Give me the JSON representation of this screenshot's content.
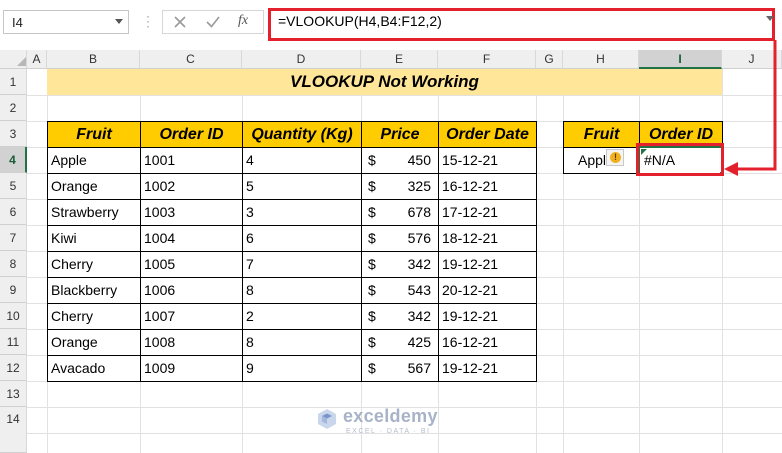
{
  "formula_bar": {
    "name_box": "I4",
    "formula": "=VLOOKUP(H4,B4:F12,2)",
    "fx_label": "fx"
  },
  "columns": [
    "A",
    "B",
    "C",
    "D",
    "E",
    "F",
    "G",
    "H",
    "I",
    "J"
  ],
  "rows": [
    "1",
    "2",
    "3",
    "4",
    "5",
    "6",
    "7",
    "8",
    "9",
    "10",
    "11",
    "12",
    "13",
    "14"
  ],
  "selected_cell": "I4",
  "title": "VLOOKUP Not Working",
  "table": {
    "headers": [
      "Fruit",
      "Order ID",
      "Quantity (Kg)",
      "Price",
      "Order Date"
    ],
    "rows": [
      {
        "fruit": "Apple",
        "order_id": "1001",
        "qty": "4",
        "currency": "$",
        "price": "450",
        "date": "15-12-21"
      },
      {
        "fruit": "Orange",
        "order_id": "1002",
        "qty": "5",
        "currency": "$",
        "price": "325",
        "date": "16-12-21"
      },
      {
        "fruit": "Strawberry",
        "order_id": "1003",
        "qty": "3",
        "currency": "$",
        "price": "678",
        "date": "17-12-21"
      },
      {
        "fruit": "Kiwi",
        "order_id": "1004",
        "qty": "6",
        "currency": "$",
        "price": "576",
        "date": "18-12-21"
      },
      {
        "fruit": "Cherry",
        "order_id": "1005",
        "qty": "7",
        "currency": "$",
        "price": "342",
        "date": "19-12-21"
      },
      {
        "fruit": "Blackberry",
        "order_id": "1006",
        "qty": "8",
        "currency": "$",
        "price": "543",
        "date": "20-12-21"
      },
      {
        "fruit": "Cherry",
        "order_id": "1007",
        "qty": "2",
        "currency": "$",
        "price": "342",
        "date": "19-12-21"
      },
      {
        "fruit": "Orange",
        "order_id": "1008",
        "qty": "8",
        "currency": "$",
        "price": "425",
        "date": "16-12-21"
      },
      {
        "fruit": "Avacado",
        "order_id": "1009",
        "qty": "9",
        "currency": "$",
        "price": "567",
        "date": "19-12-21"
      }
    ]
  },
  "lookup": {
    "headers": [
      "Fruit",
      "Order ID"
    ],
    "fruit": "Appl",
    "result": "#N/A",
    "error_glyph": "!"
  },
  "watermark": {
    "brand": "exceldemy",
    "tagline": "EXCEL · DATA · BI"
  },
  "colors": {
    "header_fill": "#ffcc00",
    "title_fill": "#ffe699",
    "annotation": "#e3202b",
    "excel_green": "#217346"
  }
}
